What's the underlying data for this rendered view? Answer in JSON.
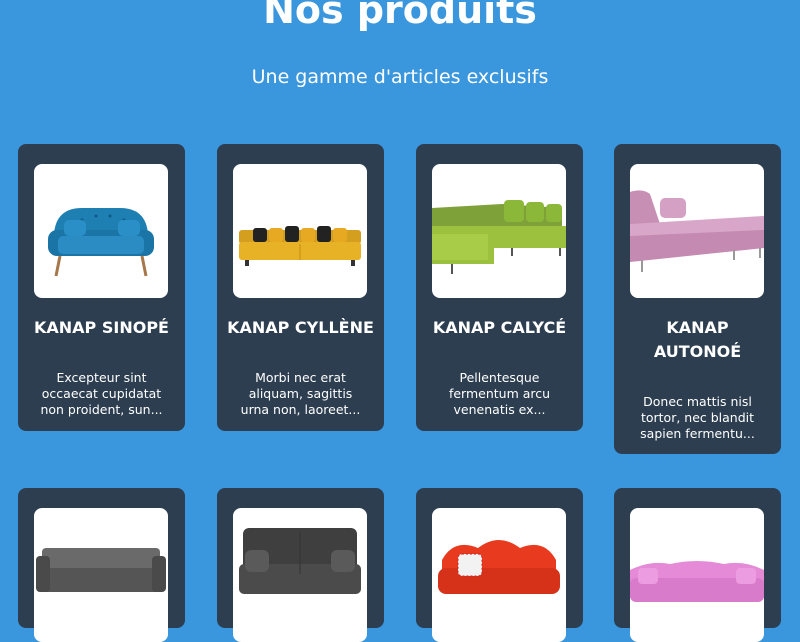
{
  "header": {
    "title": "Nos produits",
    "subtitle": "Une gamme d'articles exclusifs"
  },
  "colors": {
    "page_background": "#3a96dd",
    "card_background": "#2c3e50",
    "text": "#ffffff"
  },
  "products": [
    {
      "name": "KANAP SINOPÉ",
      "description": "Excepteur sint occaecat cupidatat non proident, sun...",
      "image": "blue-tufted-sofa-icon"
    },
    {
      "name": "KANAP CYLLÈNE",
      "description": "Morbi nec erat aliquam, sagittis urna non, laoreet...",
      "image": "yellow-sofa-icon"
    },
    {
      "name": "KANAP CALYCÉ",
      "description": "Pellentesque fermentum arcu venenatis ex...",
      "image": "green-sectional-sofa-icon"
    },
    {
      "name": "KANAP AUTONOÉ",
      "description": "Donec mattis nisl tortor, nec blandit sapien fermentu...",
      "image": "pink-chaise-sofa-icon"
    },
    {
      "name": "",
      "description": "",
      "image": "grey-sofa-icon"
    },
    {
      "name": "",
      "description": "",
      "image": "dark-grey-sofa-icon"
    },
    {
      "name": "",
      "description": "",
      "image": "red-curved-sofa-icon"
    },
    {
      "name": "",
      "description": "",
      "image": "pink-tufted-sofa-icon"
    }
  ]
}
